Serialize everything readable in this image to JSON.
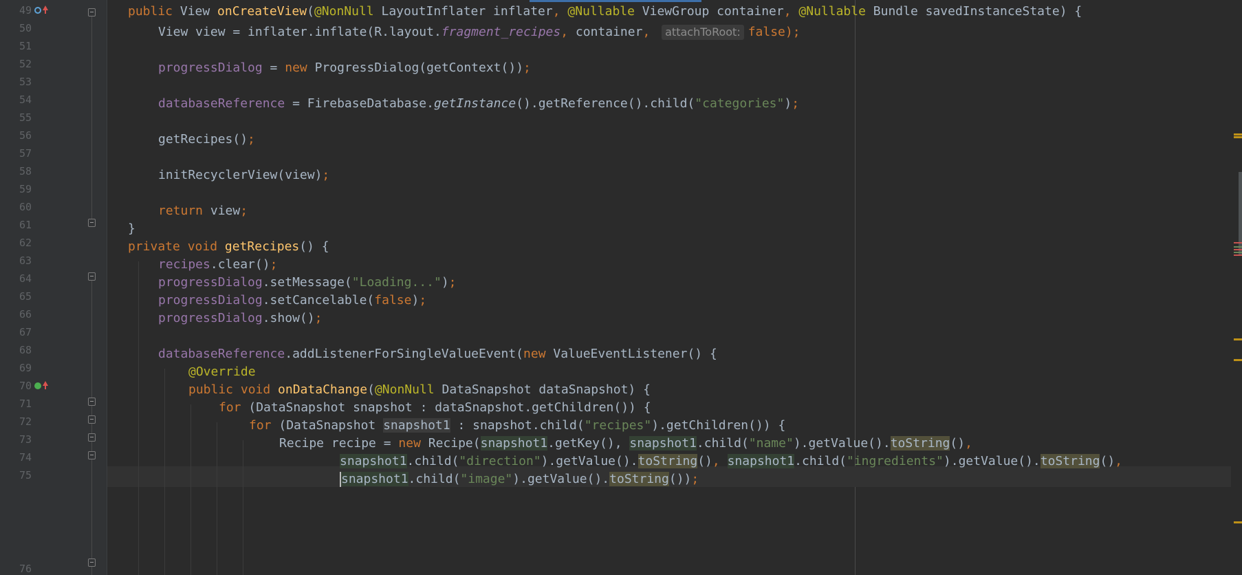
{
  "editor": {
    "language": "java",
    "caret_line": 75,
    "inlay_hint": "attachToRoot:",
    "lines": [
      {
        "n": "49"
      },
      {
        "n": "50"
      },
      {
        "n": "51"
      },
      {
        "n": "52"
      },
      {
        "n": "53"
      },
      {
        "n": "54"
      },
      {
        "n": "55"
      },
      {
        "n": "56"
      },
      {
        "n": "57"
      },
      {
        "n": "58"
      },
      {
        "n": "59"
      },
      {
        "n": "60"
      },
      {
        "n": "61"
      },
      {
        "n": "62"
      },
      {
        "n": "63"
      },
      {
        "n": "64"
      },
      {
        "n": "65"
      },
      {
        "n": "66"
      },
      {
        "n": "67"
      },
      {
        "n": "68"
      },
      {
        "n": "69"
      },
      {
        "n": "70"
      },
      {
        "n": "71"
      },
      {
        "n": "72"
      },
      {
        "n": "73"
      },
      {
        "n": "74"
      },
      {
        "n": "75"
      },
      {
        "n": "76"
      }
    ]
  },
  "code": {
    "l49": {
      "mod": "public ",
      "type": "View ",
      "method": "onCreateView",
      "p1": "(",
      "ann1": "@NonNull ",
      "t1": "LayoutInflater inflater",
      "c1": ", ",
      "ann2": "@Nullable ",
      "t2": "ViewGroup container",
      "c2": ", ",
      "ann3": "@Nullable ",
      "t3": "Bundle savedInstanceState) {"
    },
    "l50": {
      "a": "View view = inflater.inflate(R.layout.",
      "field": "fragment_recipes",
      "c1": ", ",
      "b": "container",
      "c2": ", ",
      "kw": "false",
      "end": ");"
    },
    "l52": {
      "field": "progressDialog",
      "a": " = ",
      "kw": "new ",
      "b": "ProgressDialog(getContext())",
      "end": ";"
    },
    "l54": {
      "field": "databaseReference",
      "a": " = FirebaseDatabase.",
      "m": "getInstance",
      "b": "().getReference().child(",
      "str": "\"categories\"",
      "c": ")",
      "end": ";"
    },
    "l56": {
      "a": "getRecipes()",
      "end": ";"
    },
    "l58": {
      "a": "initRecyclerView(view)",
      "end": ";"
    },
    "l60": {
      "kw": "return ",
      "a": "view",
      "end": ";"
    },
    "l61": {
      "a": "}"
    },
    "l62": {
      "kw": "private void ",
      "method": "getRecipes",
      "a": "() {"
    },
    "l63": {
      "field": "recipes",
      "a": ".clear()",
      "end": ";"
    },
    "l64": {
      "field": "progressDialog",
      "a": ".setMessage(",
      "str": "\"Loading...\"",
      "b": ")",
      "end": ";"
    },
    "l65": {
      "field": "progressDialog",
      "a": ".setCancelable(",
      "kw": "false",
      "b": ")",
      "end": ";"
    },
    "l66": {
      "field": "progressDialog",
      "a": ".show()",
      "end": ";"
    },
    "l68": {
      "field": "databaseReference",
      "a": ".addListenerForSingleValueEvent(",
      "kw": "new ",
      "b": "ValueEventListener() {"
    },
    "l69": {
      "ann": "@Override"
    },
    "l70": {
      "kw": "public void ",
      "method": "onDataChange",
      "a": "(",
      "ann": "@NonNull ",
      "b": "DataSnapshot dataSnapshot) {"
    },
    "l71": {
      "kw": "for ",
      "a": "(DataSnapshot snapshot : dataSnapshot.getChildren()) {"
    },
    "l72": {
      "kw": "for ",
      "a": "(DataSnapshot ",
      "var": "snapshot1",
      "b": " : snapshot.child(",
      "str": "\"recipes\"",
      "c": ").getChildren()) {"
    },
    "l73": {
      "a": "Recipe recipe = ",
      "kw": "new ",
      "b": "Recipe(",
      "v1": "snapshot1",
      "c": ".getKey(), ",
      "v2": "snapshot1",
      "d": ".child(",
      "str": "\"name\"",
      "e": ").getValue().",
      "ts": "toString",
      "f": "()",
      "g": ","
    },
    "l74": {
      "v1": "snapshot1",
      "a": ".child(",
      "s1": "\"direction\"",
      "b": ").getValue().",
      "ts1": "toString",
      "c": "()",
      "cm": ", ",
      "v2": "snapshot1",
      "d": ".child(",
      "s2": "\"ingredients\"",
      "e": ").getValue().",
      "ts2": "toString",
      "f": "()",
      "g": ","
    },
    "l75": {
      "v1": "snapshot1",
      "a": ".child(",
      "str": "\"image\"",
      "b": ").getValue().",
      "ts": "toString",
      "c": "())",
      "end": ";"
    }
  },
  "colors": {
    "background": "#2b2b2b",
    "gutter": "#313335",
    "keyword": "#cc7832",
    "annotation": "#bbb529",
    "method": "#ffc66d",
    "field": "#9876aa",
    "string": "#6a8759",
    "text": "#a9b7c6",
    "line_number": "#606366"
  }
}
